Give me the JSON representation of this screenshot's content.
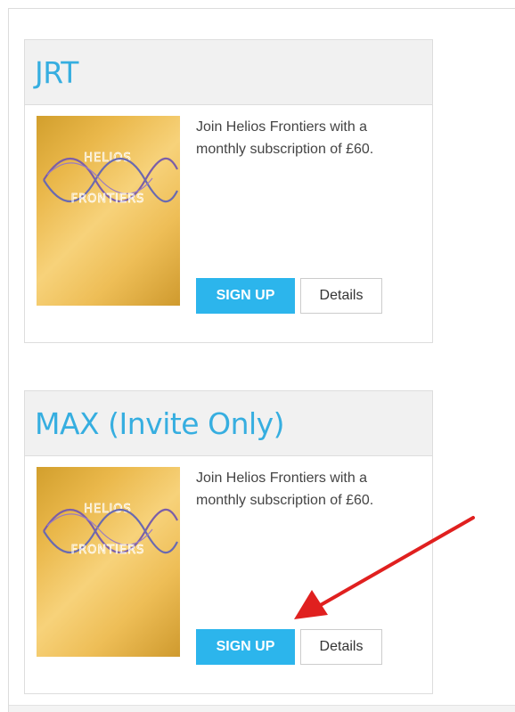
{
  "plans": [
    {
      "title": "JRT",
      "description": "Join Helios Frontiers with a monthly subscription of £60.",
      "signup_label": "SIGN UP",
      "details_label": "Details",
      "logo_lines": [
        "HELIOS",
        "FRONTIERS"
      ]
    },
    {
      "title": "MAX (Invite Only)",
      "description": "Join Helios Frontiers with a monthly subscription of £60.",
      "signup_label": "SIGN UP",
      "details_label": "Details",
      "logo_lines": [
        "HELIOS",
        "FRONTIERS"
      ]
    }
  ],
  "annotation": {
    "arrow_color": "#e0201f",
    "icon": "red-arrow-icon"
  },
  "colors": {
    "title": "#36aee0",
    "signup_bg": "#2cb5ec",
    "header_bg": "#f1f1f1"
  }
}
